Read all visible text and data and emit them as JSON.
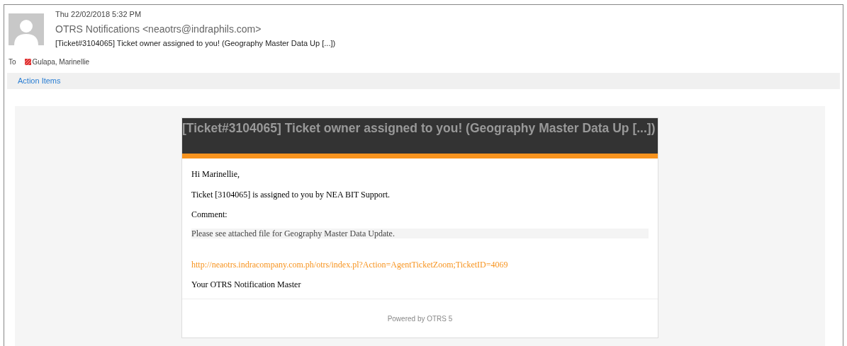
{
  "message": {
    "date": "Thu 22/02/2018 5:32 PM",
    "sender": "OTRS Notifications <neaotrs@indraphils.com>",
    "subject": "[Ticket#3104065] Ticket owner assigned to you! (Geography Master Data Up [...])",
    "to_label": "To",
    "recipient": "Gulapa, Marinellie"
  },
  "action_items": "Action Items",
  "email": {
    "heading": "[Ticket#3104065] Ticket owner assigned to you! (Geography Master Data Up [...])",
    "greeting": "Hi Marinellie,",
    "assignment": "Ticket [3104065] is assigned to you by NEA BIT Support.",
    "comment_label": "Comment:",
    "comment": "Please see attached file for Geography Master Data Update.",
    "link": "http://neaotrs.indracompany.com.ph/otrs/index.pl?Action=AgentTicketZoom;TicketID=4069",
    "signature": "Your OTRS Notification Master",
    "footer": "Powered by OTRS 5"
  }
}
